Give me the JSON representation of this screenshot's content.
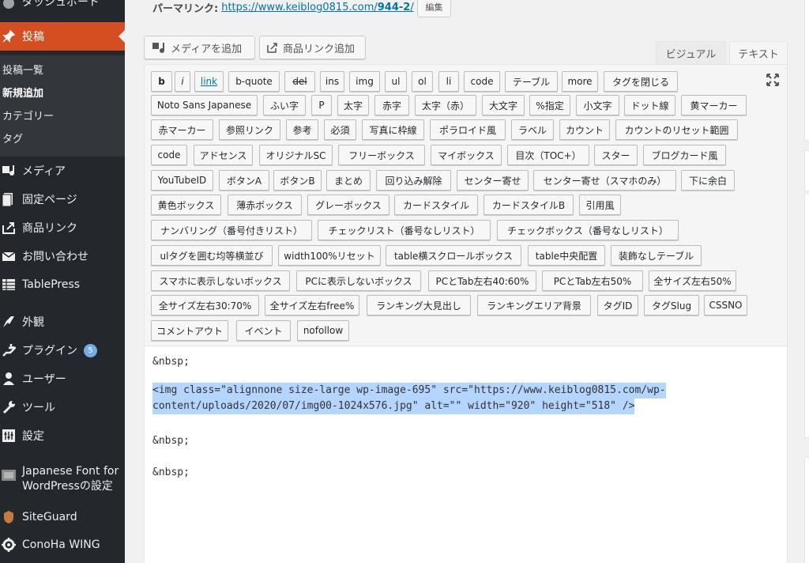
{
  "sidebar": {
    "dashboard_label": "ダッシュボード",
    "posts_label": "投稿",
    "sub_items": [
      "投稿一覧",
      "新規追加",
      "カテゴリー",
      "タグ"
    ],
    "menu": [
      {
        "label": "メディア",
        "icon": "media-icon"
      },
      {
        "label": "固定ページ",
        "icon": "pages-icon"
      },
      {
        "label": "商品リンク",
        "icon": "product-link-icon"
      },
      {
        "label": "お問い合わせ",
        "icon": "mail-icon"
      },
      {
        "label": "TablePress",
        "icon": "table-icon"
      },
      {
        "label": "外観",
        "icon": "appearance-icon"
      },
      {
        "label": "プラグイン",
        "icon": "plugins-icon",
        "badge": "5"
      },
      {
        "label": "ユーザー",
        "icon": "users-icon"
      },
      {
        "label": "ツール",
        "icon": "tools-icon"
      },
      {
        "label": "設定",
        "icon": "settings-icon"
      },
      {
        "label": "Japanese Font for",
        "label2": "WordPressの設定",
        "icon": "font-icon"
      },
      {
        "label": "SiteGuard",
        "icon": "siteguard-icon"
      },
      {
        "label": "ConoHa WING",
        "icon": "conoha-icon"
      }
    ]
  },
  "permalink": {
    "label": "パーマリンク:",
    "url_prefix": "https://www.keiblog0815.com/",
    "url_slug": "944-2",
    "url_suffix": "/",
    "edit_label": "編集"
  },
  "media": {
    "add_media_label": "メディアを追加",
    "product_link_label": "商品リンク追加"
  },
  "tabs": {
    "visual": "ビジュアル",
    "text": "テキスト"
  },
  "toolbar_buttons": [
    [
      "b",
      "i",
      "link",
      "b-quote",
      "del",
      "ins",
      "img",
      "ul",
      "ol",
      "li",
      "code",
      "テーブル",
      "more",
      "タグを閉じる"
    ],
    [
      "Noto Sans Japanese",
      "ふい字",
      "P",
      "太字",
      "赤字",
      "太字（赤）",
      "大文字",
      "%指定",
      "小文字",
      "ドット線",
      "黄マーカー"
    ],
    [
      "赤マーカー",
      "参照リンク",
      "参考",
      "必須",
      "写真に枠線",
      "ポラロイド風",
      "ラベル",
      "カウント",
      "カウントのリセット範囲"
    ],
    [
      "code",
      "アドセンス",
      "オリジナルSC",
      "フリーボックス",
      "マイボックス",
      "目次（TOC+）",
      "スター",
      "ブログカード風"
    ],
    [
      "YouTubeID",
      "ボタンA",
      "ボタンB",
      "まとめ",
      "回り込み解除",
      "センター寄せ",
      "センター寄せ（スマホのみ）",
      "下に余白"
    ],
    [
      "黄色ボックス",
      "薄赤ボックス",
      "グレーボックス",
      "カードスタイル",
      "カードスタイルB",
      "引用風"
    ],
    [
      "ナンバリング（番号付きリスト）",
      "チェックリスト（番号なしリスト）",
      "チェックボックス（番号なしリスト）"
    ],
    [
      "ulタグを囲む均等横並び",
      "width100%リセット",
      "table横スクロールボックス",
      "table中央配置",
      "装飾なしテーブル"
    ],
    [
      "スマホに表示しないボックス",
      "PCに表示しないボックス",
      "PCとTab左右40:60%",
      "PCとTab左右50%",
      "全サイズ左右50%"
    ],
    [
      "全サイズ左右30:70%",
      "全サイズ左右free%",
      "ランキング大見出し",
      "ランキングエリア背景",
      "タグID",
      "タグSlug",
      "CSSNO"
    ],
    [
      "コメントアウト",
      "イベント",
      "nofollow"
    ]
  ],
  "content": {
    "line1": "&nbsp;",
    "img_line1": "<img class=\"alignnone size-large wp-image-695\" src=\"https://www.keiblog0815.com/wp-",
    "img_line2": "content/uploads/2020/07/img00-1024x576.jpg\" alt=\"\" width=\"920\" height=\"518\" />",
    "line4": "&nbsp;",
    "line5": "&nbsp;"
  }
}
